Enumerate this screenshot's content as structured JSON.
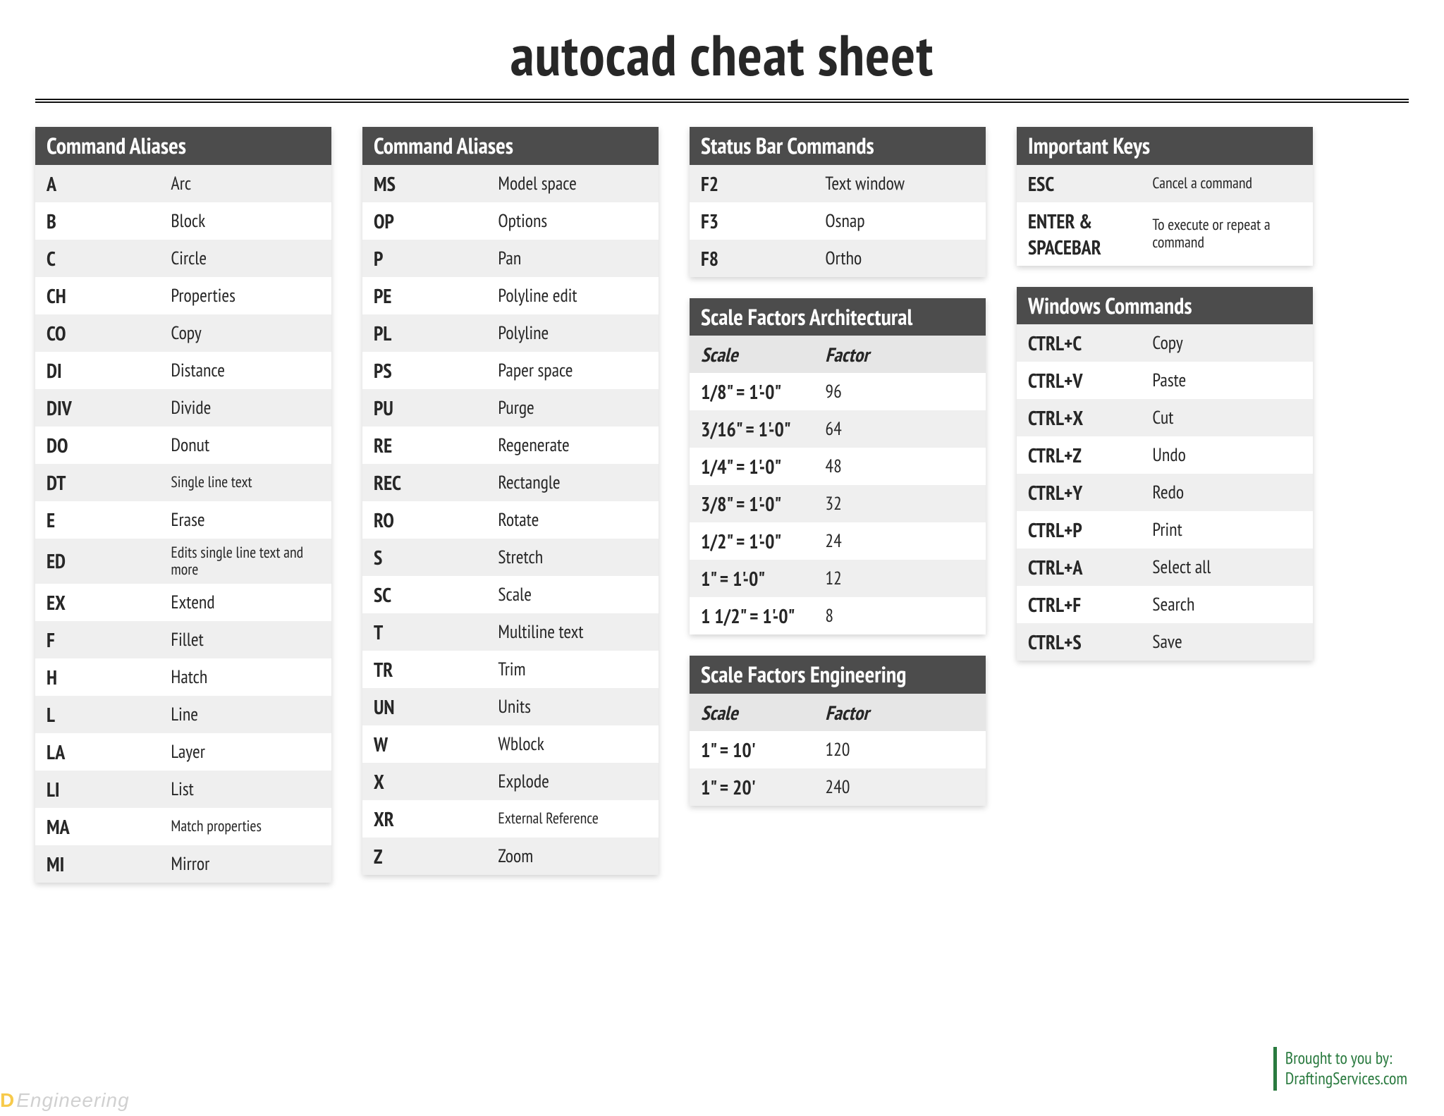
{
  "title": "autocad cheat sheet",
  "credit_line1": "Brought to you by:",
  "credit_line2": "DraftingServices.com",
  "watermark_logo": "D",
  "watermark_text": "Engineering",
  "headers": {
    "aliases1": "Command Aliases",
    "aliases2": "Command Aliases",
    "status": "Status Bar Commands",
    "scale_arch": "Scale Factors Architectural",
    "scale_eng": "Scale Factors Engineering",
    "important": "Important Keys",
    "windows": "Windows Commands",
    "scale_col1": "Scale",
    "scale_col2": "Factor"
  },
  "aliases1": [
    {
      "k": "A",
      "v": "Arc"
    },
    {
      "k": "B",
      "v": "Block"
    },
    {
      "k": "C",
      "v": "Circle"
    },
    {
      "k": "CH",
      "v": "Properties"
    },
    {
      "k": "CO",
      "v": "Copy"
    },
    {
      "k": "DI",
      "v": "Distance"
    },
    {
      "k": "DIV",
      "v": "Divide"
    },
    {
      "k": "DO",
      "v": "Donut"
    },
    {
      "k": "DT",
      "v": "Single line text",
      "small": true
    },
    {
      "k": "E",
      "v": "Erase"
    },
    {
      "k": "ED",
      "v": "Edits single line text and more",
      "small": true
    },
    {
      "k": "EX",
      "v": "Extend"
    },
    {
      "k": "F",
      "v": "Fillet"
    },
    {
      "k": "H",
      "v": "Hatch"
    },
    {
      "k": "L",
      "v": "Line"
    },
    {
      "k": "LA",
      "v": "Layer"
    },
    {
      "k": "LI",
      "v": "List"
    },
    {
      "k": "MA",
      "v": "Match properties",
      "small": true
    },
    {
      "k": "MI",
      "v": "Mirror"
    }
  ],
  "aliases2": [
    {
      "k": "MS",
      "v": "Model space"
    },
    {
      "k": "OP",
      "v": "Options"
    },
    {
      "k": "P",
      "v": "Pan"
    },
    {
      "k": "PE",
      "v": "Polyline edit"
    },
    {
      "k": "PL",
      "v": "Polyline"
    },
    {
      "k": "PS",
      "v": "Paper space"
    },
    {
      "k": "PU",
      "v": "Purge"
    },
    {
      "k": "RE",
      "v": "Regenerate"
    },
    {
      "k": "REC",
      "v": "Rectangle"
    },
    {
      "k": "RO",
      "v": "Rotate"
    },
    {
      "k": "S",
      "v": "Stretch"
    },
    {
      "k": "SC",
      "v": "Scale"
    },
    {
      "k": "T",
      "v": "Multiline text"
    },
    {
      "k": "TR",
      "v": "Trim"
    },
    {
      "k": "UN",
      "v": "Units"
    },
    {
      "k": "W",
      "v": "Wblock"
    },
    {
      "k": "X",
      "v": "Explode"
    },
    {
      "k": "XR",
      "v": "External Reference",
      "small": true
    },
    {
      "k": "Z",
      "v": "Zoom"
    }
  ],
  "status": [
    {
      "k": "F2",
      "v": "Text window"
    },
    {
      "k": "F3",
      "v": "Osnap"
    },
    {
      "k": "F8",
      "v": "Ortho"
    }
  ],
  "scale_arch": [
    {
      "k": "1/8\" = 1'-0\"",
      "v": "96"
    },
    {
      "k": "3/16\" = 1'-0\"",
      "v": "64"
    },
    {
      "k": "1/4\" = 1'-0\"",
      "v": "48"
    },
    {
      "k": "3/8\" = 1'-0\"",
      "v": "32"
    },
    {
      "k": "1/2\" = 1'-0\"",
      "v": "24"
    },
    {
      "k": "1\" = 1'-0\"",
      "v": "12"
    },
    {
      "k": "1 1/2\" = 1'-0\"",
      "v": "8"
    }
  ],
  "scale_eng": [
    {
      "k": "1\" = 10'",
      "v": "120"
    },
    {
      "k": "1\" = 20'",
      "v": "240"
    }
  ],
  "important": [
    {
      "k": "ESC",
      "v": "Cancel a command",
      "small": true
    },
    {
      "k": "ENTER & SPACEBAR",
      "v": "To execute or repeat a command",
      "small": true
    }
  ],
  "windows": [
    {
      "k": "CTRL+C",
      "v": "Copy"
    },
    {
      "k": "CTRL+V",
      "v": "Paste"
    },
    {
      "k": "CTRL+X",
      "v": "Cut"
    },
    {
      "k": "CTRL+Z",
      "v": "Undo"
    },
    {
      "k": "CTRL+Y",
      "v": "Redo"
    },
    {
      "k": "CTRL+P",
      "v": "Print"
    },
    {
      "k": "CTRL+A",
      "v": "Select all"
    },
    {
      "k": "CTRL+F",
      "v": "Search"
    },
    {
      "k": "CTRL+S",
      "v": "Save"
    }
  ]
}
